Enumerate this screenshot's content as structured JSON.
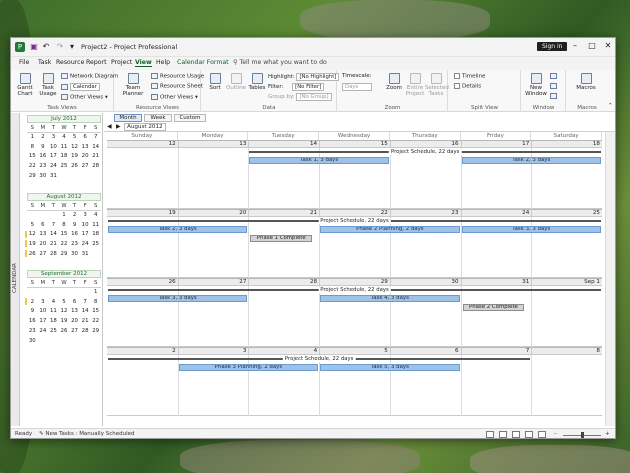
{
  "window": {
    "title": "Project2  -  Project Professional",
    "sign_in": "Sign in"
  },
  "menu": {
    "items": [
      "File",
      "Task",
      "Resource",
      "Report",
      "Project",
      "View",
      "Help",
      "Calendar Format"
    ],
    "active": "View",
    "tell_me": "Tell me what you want to do"
  },
  "ribbon": {
    "task_views": {
      "label": "Task Views",
      "gantt": "Gantt Chart",
      "task_usage": "Task Usage",
      "network": "Network Diagram",
      "calendar": "Calendar",
      "other": "Other Views"
    },
    "resource_views": {
      "label": "Resource Views",
      "team_planner": "Team Planner",
      "usage": "Resource Usage",
      "sheet": "Resource Sheet",
      "other": "Other Views"
    },
    "data": {
      "label": "Data",
      "sort": "Sort",
      "outline": "Outline",
      "tables": "Tables",
      "highlight": "Highlight:",
      "highlight_val": "[No Highlight]",
      "filter": "Filter:",
      "filter_val": "[No Filter]",
      "group": "Group by:",
      "group_val": "[No Group]"
    },
    "zoom": {
      "label": "Zoom",
      "timescale": "Timescale:",
      "timescale_val": "Days",
      "zoom_btn": "Zoom",
      "entire": "Entire Project",
      "selected": "Selected Tasks"
    },
    "split": {
      "label": "Split View",
      "timeline": "Timeline",
      "details": "Details"
    },
    "window": {
      "label": "Window",
      "new_window": "New Window"
    },
    "macros": {
      "label": "Macros",
      "macros": "Macros"
    }
  },
  "side": {
    "tab_label": "CALENDAR"
  },
  "mini_calendars": [
    {
      "title": "July 2012",
      "days": [
        "S",
        "M",
        "T",
        "W",
        "T",
        "F",
        "S"
      ],
      "weeks": [
        [
          "1",
          "2",
          "3",
          "4",
          "5",
          "6",
          "7"
        ],
        [
          "8",
          "9",
          "10",
          "11",
          "12",
          "13",
          "14"
        ],
        [
          "15",
          "16",
          "17",
          "18",
          "19",
          "20",
          "21"
        ],
        [
          "22",
          "23",
          "24",
          "25",
          "26",
          "27",
          "28"
        ],
        [
          "29",
          "30",
          "31",
          "",
          "",
          "",
          ""
        ]
      ]
    },
    {
      "title": "August 2012",
      "days": [
        "S",
        "M",
        "T",
        "W",
        "T",
        "F",
        "S"
      ],
      "weeks": [
        [
          "",
          "",
          "",
          "1",
          "2",
          "3",
          "4"
        ],
        [
          "5",
          "6",
          "7",
          "8",
          "9",
          "10",
          "11"
        ],
        [
          "12",
          "13",
          "14",
          "15",
          "16",
          "17",
          "18"
        ],
        [
          "19",
          "20",
          "21",
          "22",
          "23",
          "24",
          "25"
        ],
        [
          "26",
          "27",
          "28",
          "29",
          "30",
          "31",
          ""
        ]
      ]
    },
    {
      "title": "September 2012",
      "days": [
        "S",
        "M",
        "T",
        "W",
        "T",
        "F",
        "S"
      ],
      "weeks": [
        [
          "",
          "",
          "",
          "",
          "",
          "",
          "1"
        ],
        [
          "2",
          "3",
          "4",
          "5",
          "6",
          "7",
          "8"
        ],
        [
          "9",
          "10",
          "11",
          "12",
          "13",
          "14",
          "15"
        ],
        [
          "16",
          "17",
          "18",
          "19",
          "20",
          "21",
          "22"
        ],
        [
          "23",
          "24",
          "25",
          "26",
          "27",
          "28",
          "29"
        ],
        [
          "30",
          "",
          "",
          "",
          "",
          "",
          ""
        ]
      ]
    }
  ],
  "view_tabs": [
    "Month",
    "Week",
    "Custom"
  ],
  "current_month": "August 2012",
  "day_headers": [
    "Sunday",
    "Monday",
    "Tuesday",
    "Wednesday",
    "Thursday",
    "Friday",
    "Saturday"
  ],
  "weeks": [
    {
      "dates": [
        "12",
        "13",
        "14",
        "15",
        "16",
        "17",
        "18"
      ],
      "summary": "Project Schedule, 22 days",
      "tasks": [
        {
          "label": "Task 1, 3 days",
          "kind": "task"
        },
        {
          "label": "Task 2, 3 days",
          "kind": "task"
        }
      ]
    },
    {
      "dates": [
        "19",
        "20",
        "21",
        "22",
        "23",
        "24",
        "25"
      ],
      "summary": "Project Schedule, 22 days",
      "tasks": [
        {
          "label": "Task 2, 3 days",
          "kind": "task"
        },
        {
          "label": "Phase 2 Planning, 2 days",
          "kind": "task"
        },
        {
          "label": "Task 3, 3 days",
          "kind": "task"
        },
        {
          "label": "Phase 1 Complete",
          "kind": "phase"
        }
      ]
    },
    {
      "dates": [
        "26",
        "27",
        "28",
        "29",
        "30",
        "31",
        "Sep 1"
      ],
      "summary": "Project Schedule, 22 days",
      "tasks": [
        {
          "label": "Task 3, 3 days",
          "kind": "task"
        },
        {
          "label": "Task 4, 3 days",
          "kind": "task"
        },
        {
          "label": "Phase 2 Complete",
          "kind": "phase"
        }
      ]
    },
    {
      "dates": [
        "2",
        "3",
        "4",
        "5",
        "6",
        "7",
        "8"
      ],
      "summary": "Project Schedule, 22 days",
      "tasks": [
        {
          "label": "Phase 3 Planning, 2 days",
          "kind": "task"
        },
        {
          "label": "Task 5, 3 days",
          "kind": "task"
        }
      ]
    }
  ],
  "status": {
    "ready": "Ready",
    "new_tasks": "New Tasks : Manually Scheduled"
  }
}
